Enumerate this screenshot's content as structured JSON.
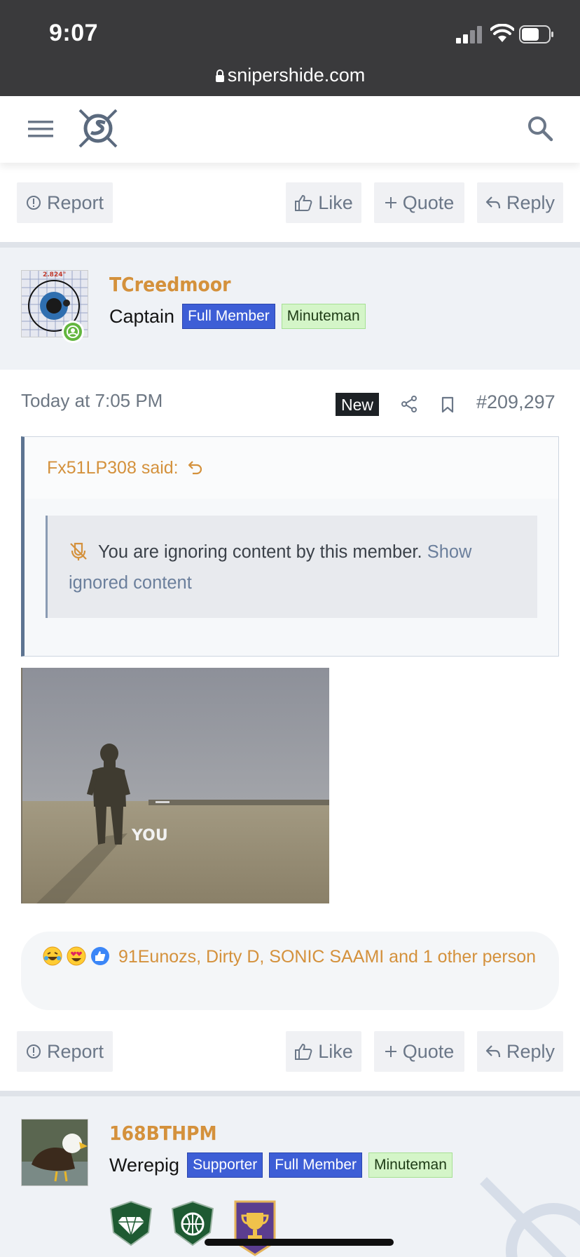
{
  "status_bar": {
    "time": "9:07",
    "url": "snipershide.com"
  },
  "actions": {
    "report": "Report",
    "like": "Like",
    "quote": "Quote",
    "reply": "Reply"
  },
  "post1_user": {
    "name": "TCreedmoor",
    "title": "Captain",
    "badges": [
      "Full Member",
      "Minuteman"
    ],
    "avatar_text": "2.824\""
  },
  "post": {
    "timestamp": "Today at 7:05 PM",
    "new_label": "New",
    "number": "#209,297"
  },
  "quote": {
    "author_said": "Fx51LP308 said:",
    "ignored_text": "You are ignoring content by this member.",
    "show_link": "Show ignored content"
  },
  "gif": {
    "caption": "YOU"
  },
  "reactions": {
    "icons": [
      "rofl-emoji",
      "heart-eyes-emoji",
      "like-emoji"
    ],
    "text": "91Eunozs, Dirty D, SONIC SAAMI and 1 other person"
  },
  "post2_user": {
    "name": "168BTHPM",
    "title": "Werepig",
    "badges": [
      "Supporter",
      "Full Member",
      "Minuteman"
    ]
  },
  "colors": {
    "accent": "#d4913c",
    "badge_blue": "#3d5ed6",
    "badge_green": "#d4f5c8",
    "muted": "#6d7783"
  }
}
